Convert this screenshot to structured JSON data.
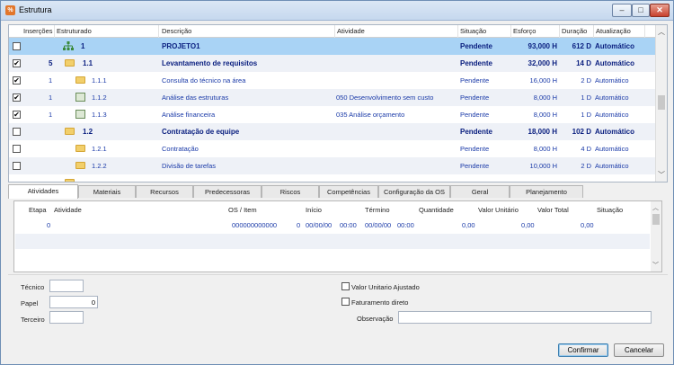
{
  "window": {
    "title": "Estrutura",
    "app_icon_glyph": "%"
  },
  "grid": {
    "columns": [
      "Inserções",
      "Estruturado",
      "Descrição",
      "Atividade",
      "Situação",
      "Esforço",
      "Duração",
      "Atualização"
    ],
    "rows": [
      {
        "checked": false,
        "insercoes": "",
        "code": "1",
        "descricao": "PROJETO1",
        "atividade": "",
        "situacao": "Pendente",
        "esforco": "93,000 H",
        "duracao": "612 D",
        "atualizacao": "Automático",
        "icon": "project",
        "bold": true,
        "selected": true
      },
      {
        "checked": true,
        "insercoes": "5",
        "code": "1.1",
        "descricao": "Levantamento de requisitos",
        "atividade": "",
        "situacao": "Pendente",
        "esforco": "32,000 H",
        "duracao": "14 D",
        "atualizacao": "Automático",
        "icon": "folder",
        "bold": true
      },
      {
        "checked": true,
        "insercoes": "1",
        "code": "1.1.1",
        "descricao": "Consulta do técnico na área",
        "atividade": "",
        "situacao": "Pendente",
        "esforco": "16,000 H",
        "duracao": "2 D",
        "atualizacao": "Automático",
        "icon": "folder"
      },
      {
        "checked": true,
        "insercoes": "1",
        "code": "1.1.2",
        "descricao": "Análise das estruturas",
        "atividade": "050  Desenvolvimento sem custo",
        "situacao": "Pendente",
        "esforco": "8,000 H",
        "duracao": "1 D",
        "atualizacao": "Automático",
        "icon": "task"
      },
      {
        "checked": true,
        "insercoes": "1",
        "code": "1.1.3",
        "descricao": "Análise financeira",
        "atividade": "035  Análise orçamento",
        "situacao": "Pendente",
        "esforco": "8,000 H",
        "duracao": "1 D",
        "atualizacao": "Automático",
        "icon": "task"
      },
      {
        "checked": false,
        "insercoes": "",
        "code": "1.2",
        "descricao": "Contratação de equipe",
        "atividade": "",
        "situacao": "Pendente",
        "esforco": "18,000 H",
        "duracao": "102 D",
        "atualizacao": "Automático",
        "icon": "folder",
        "bold": true
      },
      {
        "checked": false,
        "insercoes": "",
        "code": "1.2.1",
        "descricao": "Contratação",
        "atividade": "",
        "situacao": "Pendente",
        "esforco": "8,000 H",
        "duracao": "4 D",
        "atualizacao": "Automático",
        "icon": "folder"
      },
      {
        "checked": false,
        "insercoes": "",
        "code": "1.2.2",
        "descricao": "Divisão de tarefas",
        "atividade": "",
        "situacao": "Pendente",
        "esforco": "10,000 H",
        "duracao": "2 D",
        "atualizacao": "Automático",
        "icon": "folder"
      }
    ]
  },
  "tabs": [
    "Atividades",
    "Materiais",
    "Recursos",
    "Predecessoras",
    "Riscos",
    "Competências",
    "Configuração da OS",
    "Geral",
    "Planejamento"
  ],
  "subgrid": {
    "columns": [
      "Etapa",
      "Atividade",
      "OS / Item",
      "Início",
      "Término",
      "Quantidade",
      "Valor Unitário",
      "Valor Total",
      "Situação"
    ],
    "row": {
      "etapa": "0",
      "os_item": "000000000000",
      "os_item_sub": "0",
      "inicio_data": "00/00/00",
      "inicio_hora": "00:00",
      "termino_data": "00/00/00",
      "termino_hora": "00:00",
      "valor_unitario": "0,00",
      "valor_total": "0,00",
      "situacao": "0,00"
    }
  },
  "form": {
    "tecnico_label": "Técnico",
    "papel_label": "Papel",
    "papel_value": "0",
    "terceiro_label": "Terceiro",
    "valor_unitario_ajustado_label": "Valor Unitario Ajustado",
    "faturamento_direto_label": "Faturamento direto",
    "observacao_label": "Observação"
  },
  "buttons": {
    "confirm": "Confirmar",
    "cancel": "Cancelar"
  }
}
